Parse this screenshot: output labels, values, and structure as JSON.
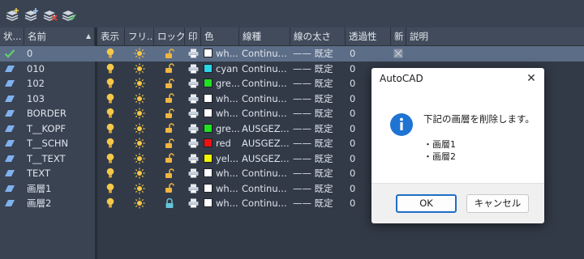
{
  "toolbar": {
    "buttons": [
      "new-layer-icon",
      "new-layer-vp-frozen-icon",
      "delete-layer-icon",
      "set-current-icon"
    ]
  },
  "header": {
    "status": "状...",
    "name": "名前",
    "on": "表示",
    "freeze": "フリ...",
    "lock": "ロック",
    "plot": "印",
    "color": "色",
    "linetype": "線種",
    "lineweight": "線の太さ",
    "transparency": "透過性",
    "new_vp": "新",
    "description": "説明"
  },
  "colors": {
    "white": "#ffffff",
    "cyan": "#2bd4e6",
    "green": "#22e021",
    "red": "#ee1212",
    "yellow": "#f4f400",
    "accent": "#1f6fc7"
  },
  "layers": [
    {
      "name": "0",
      "status": "current",
      "color_name": "wh...",
      "swatch": "#ffffff",
      "linetype": "Continu...",
      "lineweight": "—— 既定",
      "transparency": "0",
      "locked": false
    },
    {
      "name": "010",
      "status": "layer",
      "color_name": "cyan",
      "swatch": "#2bd4e6",
      "linetype": "Continu...",
      "lineweight": "—— 既定",
      "transparency": "0",
      "locked": false
    },
    {
      "name": "102",
      "status": "layer",
      "color_name": "gre...",
      "swatch": "#22e021",
      "linetype": "Continu...",
      "lineweight": "—— 既定",
      "transparency": "0",
      "locked": false
    },
    {
      "name": "103",
      "status": "layer",
      "color_name": "wh...",
      "swatch": "#ffffff",
      "linetype": "Continu...",
      "lineweight": "—— 既定",
      "transparency": "0",
      "locked": false
    },
    {
      "name": "BORDER",
      "status": "layer",
      "color_name": "wh...",
      "swatch": "#ffffff",
      "linetype": "Continu...",
      "lineweight": "—— 既定",
      "transparency": "0",
      "locked": false
    },
    {
      "name": "T__KOPF",
      "status": "layer",
      "color_name": "gre...",
      "swatch": "#22e021",
      "linetype": "AUSGEZ...",
      "lineweight": "—— 既定",
      "transparency": "0",
      "locked": false
    },
    {
      "name": "T__SCHN",
      "status": "layer",
      "color_name": "red",
      "swatch": "#ee1212",
      "linetype": "AUSGEZ...",
      "lineweight": "—— 既定",
      "transparency": "0",
      "locked": false
    },
    {
      "name": "T__TEXT",
      "status": "layer",
      "color_name": "yel...",
      "swatch": "#f4f400",
      "linetype": "AUSGEZ...",
      "lineweight": "—— 既定",
      "transparency": "0",
      "locked": false
    },
    {
      "name": "TEXT",
      "status": "layer",
      "color_name": "wh...",
      "swatch": "#ffffff",
      "linetype": "Continu...",
      "lineweight": "—— 既定",
      "transparency": "0",
      "locked": false
    },
    {
      "name": "画層1",
      "status": "layer",
      "color_name": "wh...",
      "swatch": "#ffffff",
      "linetype": "Continu...",
      "lineweight": "—— 既定",
      "transparency": "0",
      "locked": false
    },
    {
      "name": "画層2",
      "status": "layer",
      "color_name": "wh...",
      "swatch": "#ffffff",
      "linetype": "Continu...",
      "lineweight": "—— 既定",
      "transparency": "0",
      "locked": true
    }
  ],
  "dialog": {
    "title": "AutoCAD",
    "message": "下記の画層を削除します。",
    "items": [
      "・画層1",
      "・画層2"
    ],
    "ok_label": "OK",
    "cancel_label": "キャンセル"
  }
}
